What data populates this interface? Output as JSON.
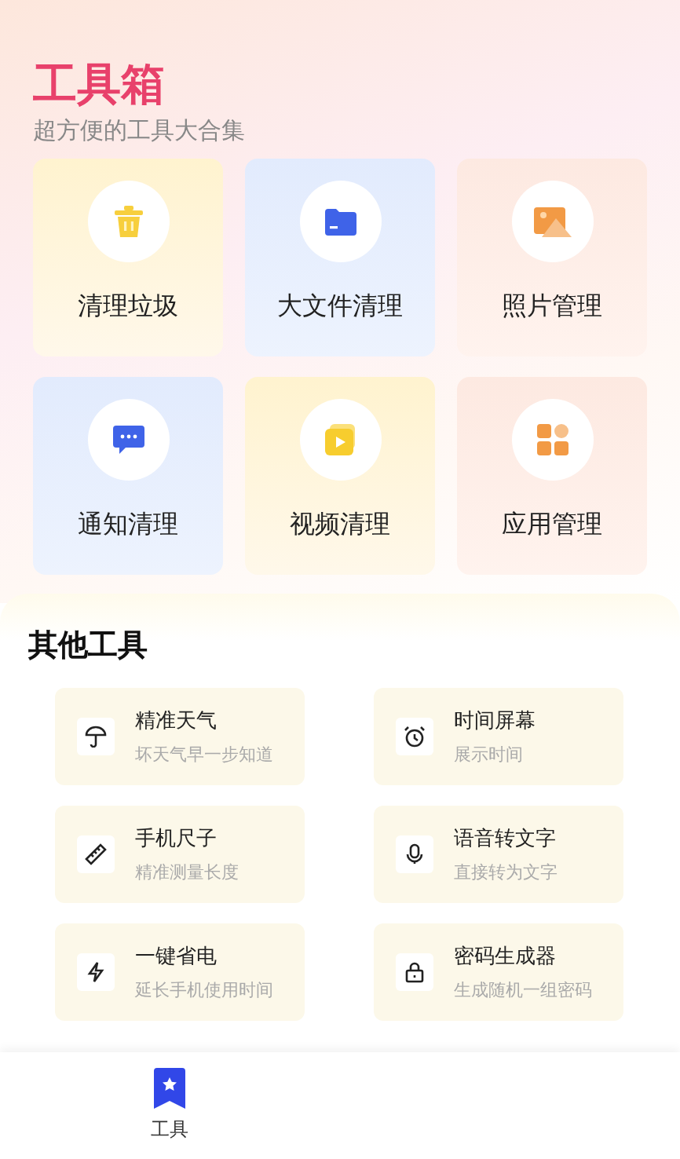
{
  "header": {
    "title": "工具箱",
    "subtitle": "超方便的工具大合集"
  },
  "tools": [
    {
      "label": "清理垃圾"
    },
    {
      "label": "大文件清理"
    },
    {
      "label": "照片管理"
    },
    {
      "label": "通知清理"
    },
    {
      "label": "视频清理"
    },
    {
      "label": "应用管理"
    }
  ],
  "other_tools": {
    "title": "其他工具",
    "items": [
      {
        "name": "精准天气",
        "desc": "坏天气早一步知道"
      },
      {
        "name": "时间屏幕",
        "desc": "展示时间"
      },
      {
        "name": "手机尺子",
        "desc": "精准测量长度"
      },
      {
        "name": "语音转文字",
        "desc": "直接转为文字"
      },
      {
        "name": "一键省电",
        "desc": "延长手机使用时间"
      },
      {
        "name": "密码生成器",
        "desc": "生成随机一组密码"
      }
    ]
  },
  "bottom_nav": [
    {
      "label": "工具",
      "selected": true
    }
  ]
}
